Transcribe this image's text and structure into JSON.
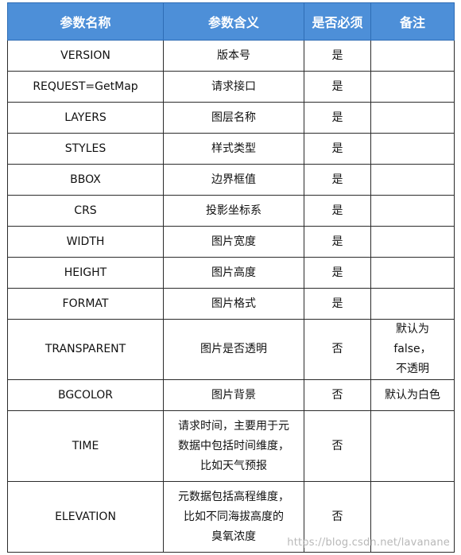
{
  "headers": [
    "参数名称",
    "参数含义",
    "是否必须",
    "备注"
  ],
  "rows": [
    {
      "name": "VERSION",
      "meaning": "版本号",
      "required": "是",
      "note": ""
    },
    {
      "name": "REQUEST=GetMap",
      "meaning": "请求接口",
      "required": "是",
      "note": ""
    },
    {
      "name": "LAYERS",
      "meaning": "图层名称",
      "required": "是",
      "note": ""
    },
    {
      "name": "STYLES",
      "meaning": "样式类型",
      "required": "是",
      "note": ""
    },
    {
      "name": "BBOX",
      "meaning": "边界框值",
      "required": "是",
      "note": ""
    },
    {
      "name": "CRS",
      "meaning": "投影坐标系",
      "required": "是",
      "note": ""
    },
    {
      "name": "WIDTH",
      "meaning": "图片宽度",
      "required": "是",
      "note": ""
    },
    {
      "name": "HEIGHT",
      "meaning": "图片高度",
      "required": "是",
      "note": ""
    },
    {
      "name": "FORMAT",
      "meaning": "图片格式",
      "required": "是",
      "note": ""
    },
    {
      "name": "TRANSPARENT",
      "meaning": "图片是否透明",
      "required": "否",
      "note": "默认为 false，\n不透明"
    },
    {
      "name": "BGCOLOR",
      "meaning": "图片背景",
      "required": "否",
      "note": "默认为白色"
    },
    {
      "name": "TIME",
      "meaning": "请求时间，主要用于元\n数据中包括时间维度，\n比如天气预报",
      "required": "否",
      "note": ""
    },
    {
      "name": "ELEVATION",
      "meaning": "元数据包括高程维度，\n比如不同海拔高度的\n臭氧浓度",
      "required": "否",
      "note": ""
    }
  ],
  "watermark": "https://blog.csdn.net/lavanane"
}
